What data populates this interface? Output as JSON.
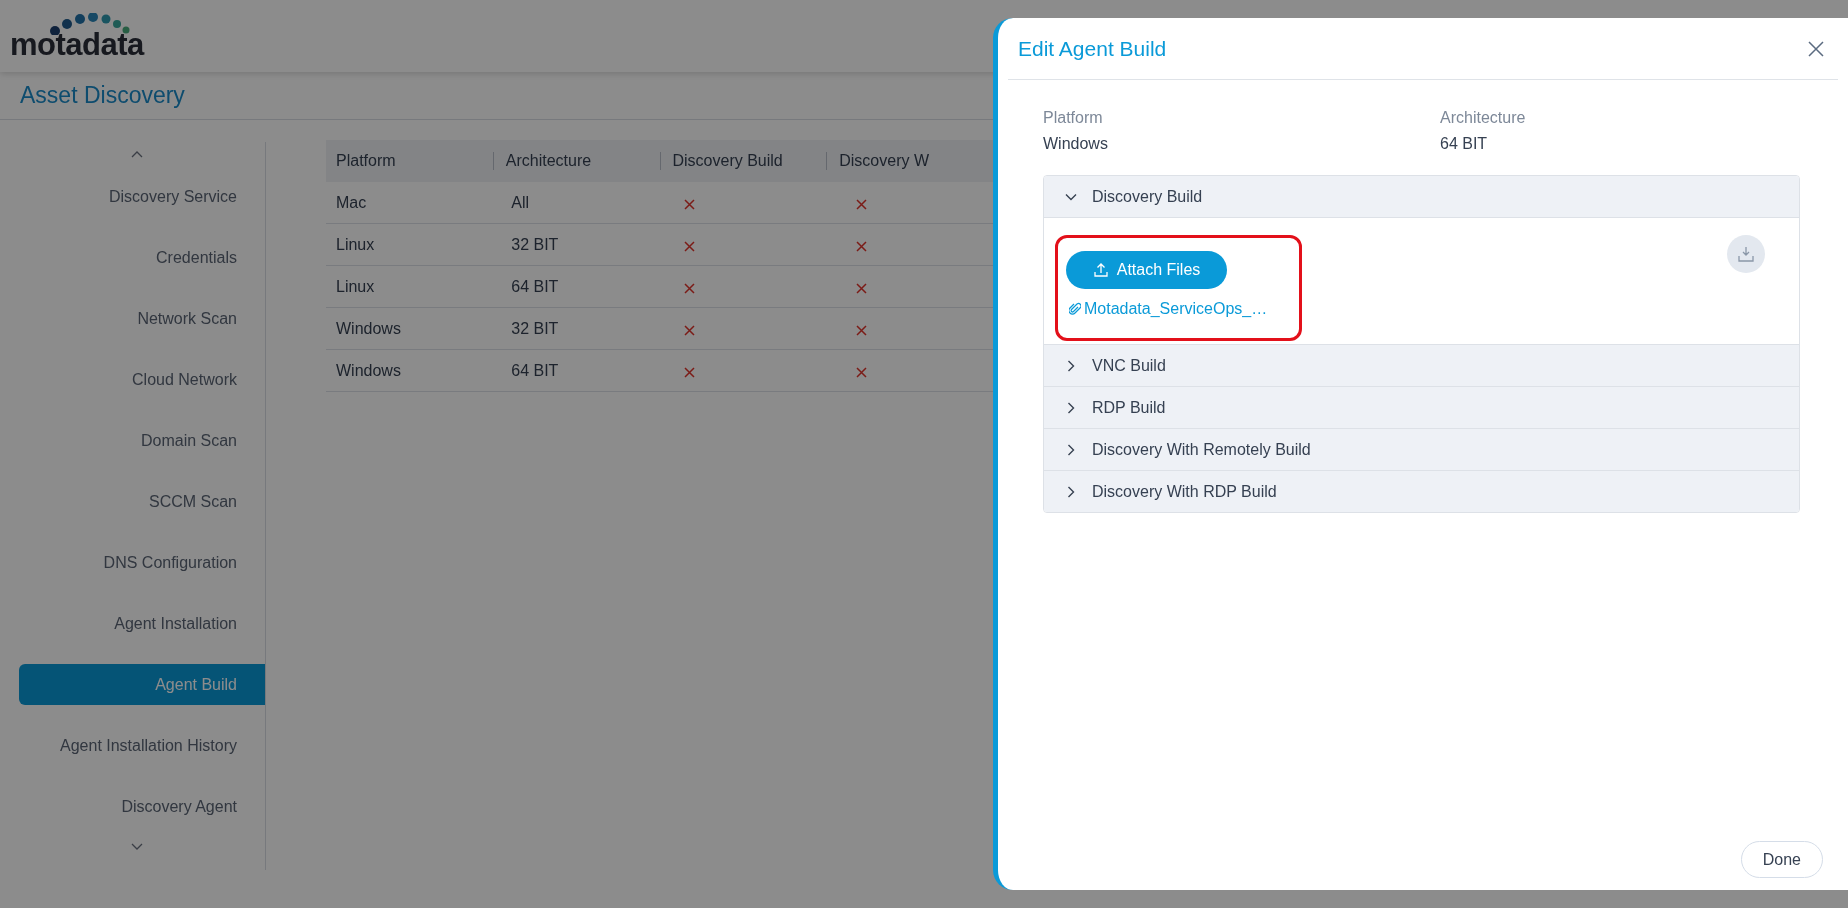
{
  "logo": {
    "text": "motadata"
  },
  "page_title": "Asset Discovery",
  "sidebar": {
    "items": [
      {
        "label": "Discovery Service",
        "selected": false
      },
      {
        "label": "Credentials",
        "selected": false
      },
      {
        "label": "Network Scan",
        "selected": false
      },
      {
        "label": "Cloud Network",
        "selected": false
      },
      {
        "label": "Domain Scan",
        "selected": false
      },
      {
        "label": "SCCM Scan",
        "selected": false
      },
      {
        "label": "DNS Configuration",
        "selected": false
      },
      {
        "label": "Agent Installation",
        "selected": false
      },
      {
        "label": "Agent Build",
        "selected": true
      },
      {
        "label": "Agent Installation History",
        "selected": false
      },
      {
        "label": "Discovery Agent",
        "selected": false
      }
    ]
  },
  "table": {
    "columns": [
      "Platform",
      "Architecture",
      "Discovery Build",
      "Discovery W"
    ],
    "rows": [
      {
        "platform": "Mac",
        "architecture": "All",
        "discovery_build": false,
        "column_4": false
      },
      {
        "platform": "Linux",
        "architecture": "32 BIT",
        "discovery_build": false,
        "column_4": false
      },
      {
        "platform": "Linux",
        "architecture": "64 BIT",
        "discovery_build": false,
        "column_4": false
      },
      {
        "platform": "Windows",
        "architecture": "32 BIT",
        "discovery_build": false,
        "column_4": false
      },
      {
        "platform": "Windows",
        "architecture": "64 BIT",
        "discovery_build": false,
        "column_4": false
      }
    ]
  },
  "modal": {
    "title": "Edit Agent Build",
    "fields": [
      {
        "label": "Platform",
        "value": "Windows"
      },
      {
        "label": "Architecture",
        "value": "64 BIT"
      }
    ],
    "sections": [
      {
        "title": "Discovery Build",
        "expanded": true,
        "attach_button": "Attach Files",
        "files": [
          "Motadata_ServiceOps_…"
        ]
      },
      {
        "title": "VNC Build",
        "expanded": false
      },
      {
        "title": "RDP Build",
        "expanded": false
      },
      {
        "title": "Discovery With Remotely Build",
        "expanded": false
      },
      {
        "title": "Discovery With RDP Build",
        "expanded": false
      }
    ],
    "done_button": "Done"
  }
}
